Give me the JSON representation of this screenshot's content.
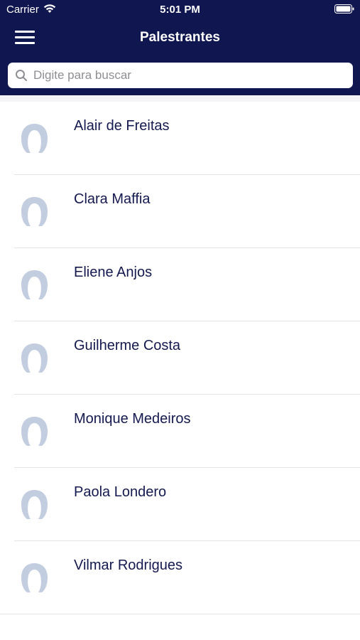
{
  "status_bar": {
    "carrier": "Carrier",
    "time": "5:01 PM"
  },
  "header": {
    "title": "Palestrantes",
    "background_color": "#0f1650"
  },
  "search": {
    "placeholder": "Digite para buscar",
    "value": ""
  },
  "speakers": [
    {
      "name": "Alair de Freitas"
    },
    {
      "name": "Clara Maffia"
    },
    {
      "name": "Eliene Anjos"
    },
    {
      "name": "Guilherme Costa"
    },
    {
      "name": "Monique Medeiros"
    },
    {
      "name": "Paola Londero"
    },
    {
      "name": "Vilmar Rodrigues"
    }
  ],
  "colors": {
    "name_text": "#14194f",
    "avatar": "#c3cde0"
  },
  "icons": {
    "menu": "hamburger-menu-icon",
    "search": "search-icon",
    "avatar": "person-placeholder-icon"
  }
}
